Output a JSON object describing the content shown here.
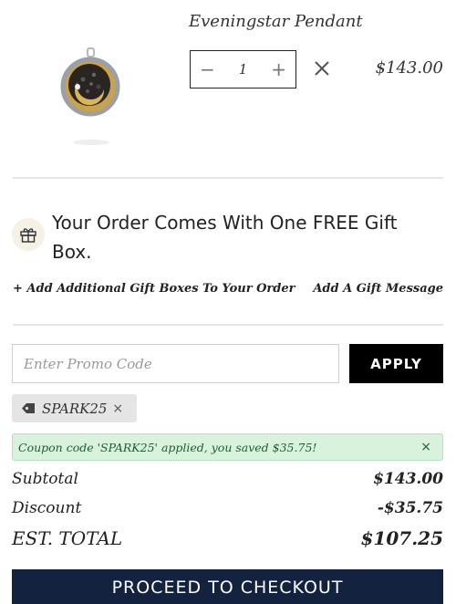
{
  "product": {
    "name": "Eveningstar Pendant",
    "quantity": "1",
    "price": "$143.00",
    "qty_minus": "−",
    "qty_plus": "+"
  },
  "gift": {
    "message": "Your Order Comes With One FREE Gift Box.",
    "add_boxes_link": "+ Add Additional Gift Boxes To Your Order",
    "gift_message_link": "Add A Gift Message"
  },
  "promo": {
    "placeholder": "Enter Promo Code",
    "value": "",
    "apply_label": "APPLY",
    "applied_code": "SPARK25",
    "chip_remove": "×",
    "success_message": "Coupon code 'SPARK25' applied, you saved $35.75!",
    "success_close": "×"
  },
  "summary": {
    "subtotal_label": "Subtotal",
    "subtotal_value": "$143.00",
    "discount_label": "Discount",
    "discount_value": "-$35.75",
    "total_label": "EST. TOTAL",
    "total_value": "$107.25"
  },
  "checkout": {
    "label": "PROCEED TO CHECKOUT"
  },
  "colors": {
    "checkout_bg": "#13223f",
    "apply_bg": "#000000",
    "success_bg": "#d9f2de",
    "gift_icon_bg": "#f5f1e6"
  }
}
